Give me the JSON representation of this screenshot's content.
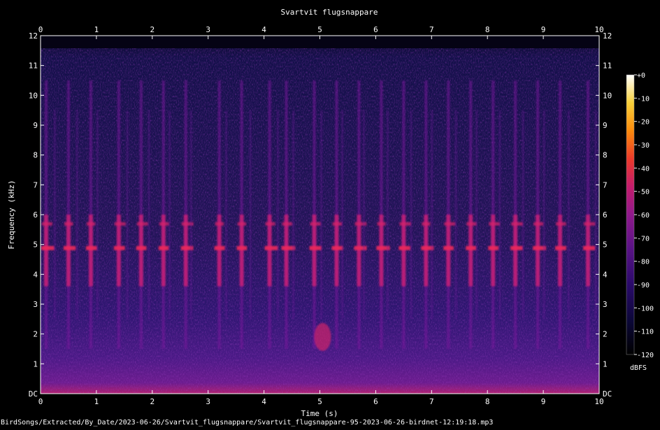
{
  "chart_data": {
    "type": "heatmap",
    "title": "Svartvit flugsnappare",
    "xlabel": "Time (s)",
    "ylabel": "Frequency (kHz)",
    "xlim": [
      0,
      10
    ],
    "ylim": [
      0,
      12
    ],
    "x_ticks": [
      "0",
      "1",
      "2",
      "3",
      "4",
      "5",
      "6",
      "7",
      "8",
      "9",
      "10"
    ],
    "y_ticks": [
      "DC",
      "1",
      "2",
      "3",
      "4",
      "5",
      "6",
      "7",
      "8",
      "9",
      "10",
      "11",
      "12"
    ],
    "colorbar": {
      "label": "dBFS",
      "ticks": [
        "+0",
        "-10",
        "-20",
        "-30",
        "-40",
        "-50",
        "-60",
        "-70",
        "-80",
        "-90",
        "-100",
        "-110",
        "-120"
      ],
      "range": [
        -120,
        0
      ]
    },
    "song_onsets_s": [
      0.1,
      0.5,
      0.9,
      1.4,
      1.8,
      2.2,
      2.6,
      3.2,
      3.6,
      4.1,
      4.4,
      4.9,
      5.3,
      5.7,
      6.1,
      6.5,
      6.9,
      7.3,
      7.7,
      8.1,
      8.5,
      8.9,
      9.3,
      9.8
    ]
  },
  "footer": {
    "filename": "BirdSongs/Extracted/By_Date/2023-06-26/Svartvit_flugsnappare/Svartvit_flugsnappare-95-2023-06-26-birdnet-12:19:18.mp3"
  },
  "colors": {
    "background": "#000000",
    "foreground": "#ffffff",
    "colormap": [
      "#000000",
      "#0c0838",
      "#2a0a6a",
      "#5a1386",
      "#90198c",
      "#c41c6c",
      "#ec3a2a",
      "#fb8a0c",
      "#f8d03a",
      "#ffffff"
    ]
  }
}
